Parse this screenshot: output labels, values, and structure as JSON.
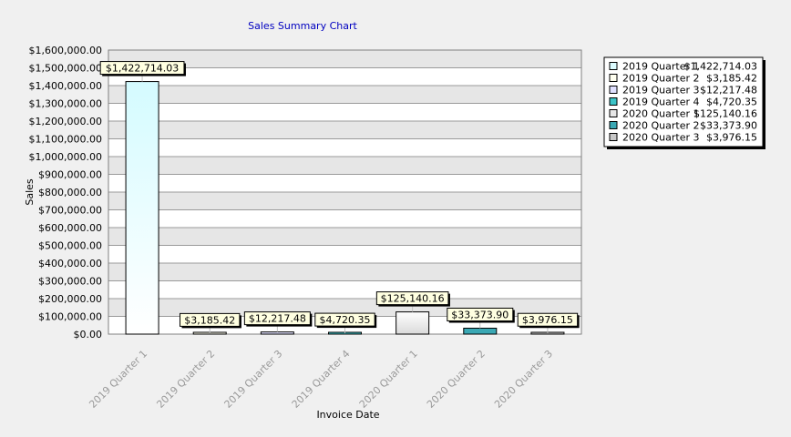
{
  "chart_data": {
    "type": "bar",
    "title": "Sales Summary Chart",
    "xlabel": "Invoice Date",
    "ylabel": "Sales",
    "ylim": [
      0,
      1600000
    ],
    "ytick_step": 100000,
    "yticks": [
      "$0.00",
      "$100,000.00",
      "$200,000.00",
      "$300,000.00",
      "$400,000.00",
      "$500,000.00",
      "$600,000.00",
      "$700,000.00",
      "$800,000.00",
      "$900,000.00",
      "$1,000,000.00",
      "$1,100,000.00",
      "$1,200,000.00",
      "$1,300,000.00",
      "$1,400,000.00",
      "$1,500,000.00",
      "$1,600,000.00"
    ],
    "categories": [
      "2019 Quarter 1",
      "2019 Quarter 2",
      "2019 Quarter 3",
      "2019 Quarter 4",
      "2020 Quarter 1",
      "2020 Quarter 2",
      "2020 Quarter 3"
    ],
    "values": [
      1422714.03,
      3185.42,
      12217.48,
      4720.35,
      125140.16,
      33373.9,
      3976.15
    ],
    "value_labels": [
      "$1,422,714.03",
      "$3,185.42",
      "$12,217.48",
      "$4,720.35",
      "$125,140.16",
      "$33,373.90",
      "$3,976.15"
    ],
    "colors": [
      "#dcfcff",
      "#fffff0",
      "#e0e0ff",
      "#3cc4c8",
      "#e6e6e6",
      "#3aa8b4",
      "#c8c8c8"
    ],
    "grid": true,
    "legend_position": "right",
    "legend": [
      {
        "name": "2019 Quarter 1",
        "value": "$1,422,714.03"
      },
      {
        "name": "2019 Quarter 2",
        "value": "$3,185.42"
      },
      {
        "name": "2019 Quarter 3",
        "value": "$12,217.48"
      },
      {
        "name": "2019 Quarter 4",
        "value": "$4,720.35"
      },
      {
        "name": "2020 Quarter 1",
        "value": "$125,140.16"
      },
      {
        "name": "2020 Quarter 2",
        "value": "$33,373.90"
      },
      {
        "name": "2020 Quarter 3",
        "value": "$3,976.15"
      }
    ]
  }
}
